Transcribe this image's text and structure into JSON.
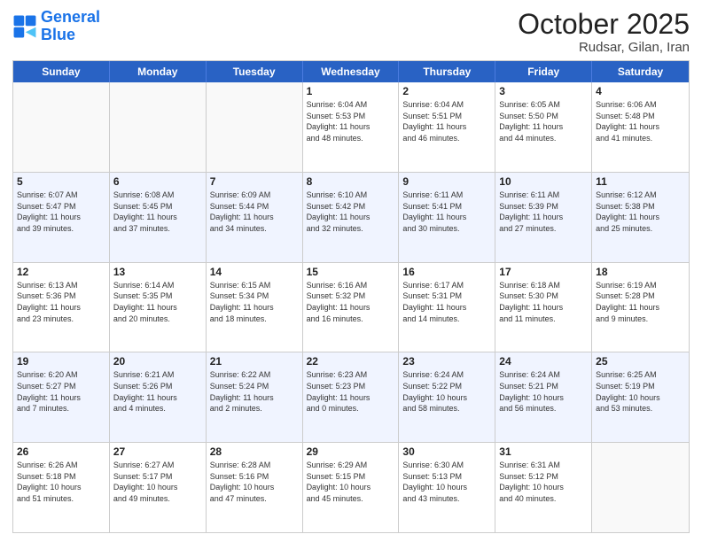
{
  "logo": {
    "line1": "General",
    "line2": "Blue"
  },
  "header": {
    "month": "October 2025",
    "location": "Rudsar, Gilan, Iran"
  },
  "weekdays": [
    "Sunday",
    "Monday",
    "Tuesday",
    "Wednesday",
    "Thursday",
    "Friday",
    "Saturday"
  ],
  "rows": [
    [
      {
        "day": "",
        "info": ""
      },
      {
        "day": "",
        "info": ""
      },
      {
        "day": "",
        "info": ""
      },
      {
        "day": "1",
        "info": "Sunrise: 6:04 AM\nSunset: 5:53 PM\nDaylight: 11 hours\nand 48 minutes."
      },
      {
        "day": "2",
        "info": "Sunrise: 6:04 AM\nSunset: 5:51 PM\nDaylight: 11 hours\nand 46 minutes."
      },
      {
        "day": "3",
        "info": "Sunrise: 6:05 AM\nSunset: 5:50 PM\nDaylight: 11 hours\nand 44 minutes."
      },
      {
        "day": "4",
        "info": "Sunrise: 6:06 AM\nSunset: 5:48 PM\nDaylight: 11 hours\nand 41 minutes."
      }
    ],
    [
      {
        "day": "5",
        "info": "Sunrise: 6:07 AM\nSunset: 5:47 PM\nDaylight: 11 hours\nand 39 minutes."
      },
      {
        "day": "6",
        "info": "Sunrise: 6:08 AM\nSunset: 5:45 PM\nDaylight: 11 hours\nand 37 minutes."
      },
      {
        "day": "7",
        "info": "Sunrise: 6:09 AM\nSunset: 5:44 PM\nDaylight: 11 hours\nand 34 minutes."
      },
      {
        "day": "8",
        "info": "Sunrise: 6:10 AM\nSunset: 5:42 PM\nDaylight: 11 hours\nand 32 minutes."
      },
      {
        "day": "9",
        "info": "Sunrise: 6:11 AM\nSunset: 5:41 PM\nDaylight: 11 hours\nand 30 minutes."
      },
      {
        "day": "10",
        "info": "Sunrise: 6:11 AM\nSunset: 5:39 PM\nDaylight: 11 hours\nand 27 minutes."
      },
      {
        "day": "11",
        "info": "Sunrise: 6:12 AM\nSunset: 5:38 PM\nDaylight: 11 hours\nand 25 minutes."
      }
    ],
    [
      {
        "day": "12",
        "info": "Sunrise: 6:13 AM\nSunset: 5:36 PM\nDaylight: 11 hours\nand 23 minutes."
      },
      {
        "day": "13",
        "info": "Sunrise: 6:14 AM\nSunset: 5:35 PM\nDaylight: 11 hours\nand 20 minutes."
      },
      {
        "day": "14",
        "info": "Sunrise: 6:15 AM\nSunset: 5:34 PM\nDaylight: 11 hours\nand 18 minutes."
      },
      {
        "day": "15",
        "info": "Sunrise: 6:16 AM\nSunset: 5:32 PM\nDaylight: 11 hours\nand 16 minutes."
      },
      {
        "day": "16",
        "info": "Sunrise: 6:17 AM\nSunset: 5:31 PM\nDaylight: 11 hours\nand 14 minutes."
      },
      {
        "day": "17",
        "info": "Sunrise: 6:18 AM\nSunset: 5:30 PM\nDaylight: 11 hours\nand 11 minutes."
      },
      {
        "day": "18",
        "info": "Sunrise: 6:19 AM\nSunset: 5:28 PM\nDaylight: 11 hours\nand 9 minutes."
      }
    ],
    [
      {
        "day": "19",
        "info": "Sunrise: 6:20 AM\nSunset: 5:27 PM\nDaylight: 11 hours\nand 7 minutes."
      },
      {
        "day": "20",
        "info": "Sunrise: 6:21 AM\nSunset: 5:26 PM\nDaylight: 11 hours\nand 4 minutes."
      },
      {
        "day": "21",
        "info": "Sunrise: 6:22 AM\nSunset: 5:24 PM\nDaylight: 11 hours\nand 2 minutes."
      },
      {
        "day": "22",
        "info": "Sunrise: 6:23 AM\nSunset: 5:23 PM\nDaylight: 11 hours\nand 0 minutes."
      },
      {
        "day": "23",
        "info": "Sunrise: 6:24 AM\nSunset: 5:22 PM\nDaylight: 10 hours\nand 58 minutes."
      },
      {
        "day": "24",
        "info": "Sunrise: 6:24 AM\nSunset: 5:21 PM\nDaylight: 10 hours\nand 56 minutes."
      },
      {
        "day": "25",
        "info": "Sunrise: 6:25 AM\nSunset: 5:19 PM\nDaylight: 10 hours\nand 53 minutes."
      }
    ],
    [
      {
        "day": "26",
        "info": "Sunrise: 6:26 AM\nSunset: 5:18 PM\nDaylight: 10 hours\nand 51 minutes."
      },
      {
        "day": "27",
        "info": "Sunrise: 6:27 AM\nSunset: 5:17 PM\nDaylight: 10 hours\nand 49 minutes."
      },
      {
        "day": "28",
        "info": "Sunrise: 6:28 AM\nSunset: 5:16 PM\nDaylight: 10 hours\nand 47 minutes."
      },
      {
        "day": "29",
        "info": "Sunrise: 6:29 AM\nSunset: 5:15 PM\nDaylight: 10 hours\nand 45 minutes."
      },
      {
        "day": "30",
        "info": "Sunrise: 6:30 AM\nSunset: 5:13 PM\nDaylight: 10 hours\nand 43 minutes."
      },
      {
        "day": "31",
        "info": "Sunrise: 6:31 AM\nSunset: 5:12 PM\nDaylight: 10 hours\nand 40 minutes."
      },
      {
        "day": "",
        "info": ""
      }
    ]
  ]
}
